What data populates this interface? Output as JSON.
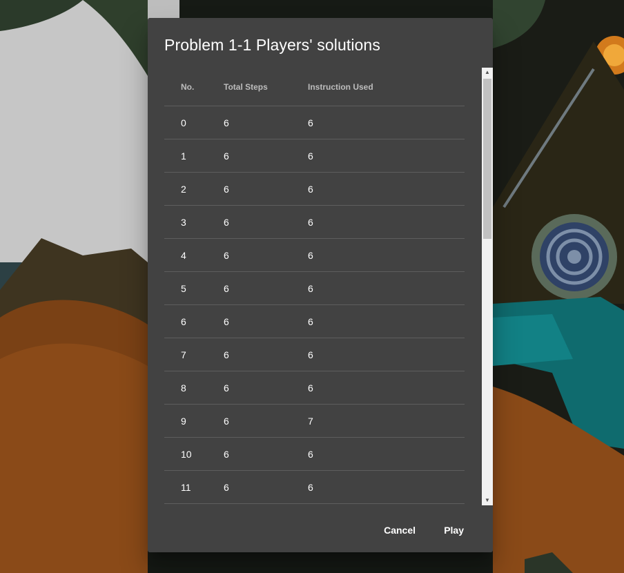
{
  "dialog": {
    "title": "Problem 1-1 Players' solutions",
    "columns": [
      "No.",
      "Total Steps",
      "Instruction Used"
    ],
    "rows": [
      {
        "no": "0",
        "total_steps": "6",
        "instruction_used": "6"
      },
      {
        "no": "1",
        "total_steps": "6",
        "instruction_used": "6"
      },
      {
        "no": "2",
        "total_steps": "6",
        "instruction_used": "6"
      },
      {
        "no": "3",
        "total_steps": "6",
        "instruction_used": "6"
      },
      {
        "no": "4",
        "total_steps": "6",
        "instruction_used": "6"
      },
      {
        "no": "5",
        "total_steps": "6",
        "instruction_used": "6"
      },
      {
        "no": "6",
        "total_steps": "6",
        "instruction_used": "6"
      },
      {
        "no": "7",
        "total_steps": "6",
        "instruction_used": "6"
      },
      {
        "no": "8",
        "total_steps": "6",
        "instruction_used": "6"
      },
      {
        "no": "9",
        "total_steps": "6",
        "instruction_used": "7"
      },
      {
        "no": "10",
        "total_steps": "6",
        "instruction_used": "6"
      },
      {
        "no": "11",
        "total_steps": "6",
        "instruction_used": "6"
      }
    ],
    "actions": {
      "cancel_label": "Cancel",
      "play_label": "Play"
    },
    "scroll_up_icon": "triangle-up",
    "scroll_down_icon": "triangle-down"
  },
  "colors": {
    "dialog_bg": "#424242",
    "divider": "#5e5e5e",
    "header_text": "#bdbdbd",
    "cell_text": "#ffffff"
  }
}
